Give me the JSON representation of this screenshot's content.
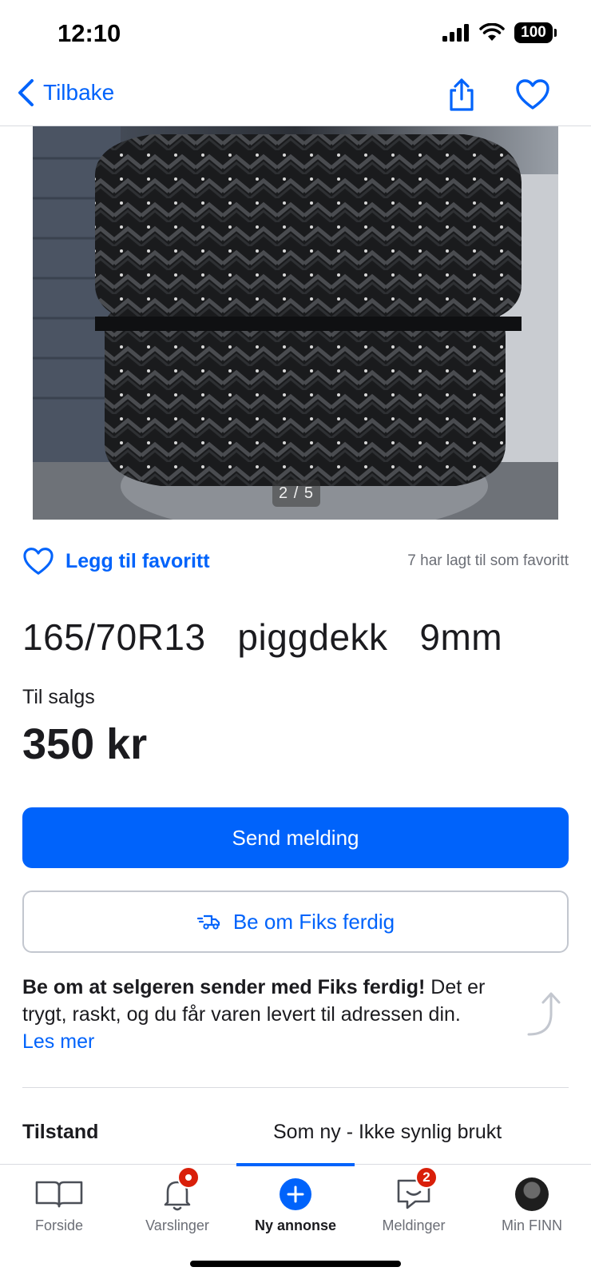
{
  "status_bar": {
    "time": "12:10",
    "battery": "100"
  },
  "nav": {
    "back_label": "Tilbake"
  },
  "gallery": {
    "counter": "2 / 5"
  },
  "favorite": {
    "action_label": "Legg til favoritt",
    "count_text": "7 har lagt til som favoritt"
  },
  "listing": {
    "title": "165/70R13   piggdekk   9mm",
    "sale_type": "Til salgs",
    "price": "350 kr"
  },
  "actions": {
    "send_message": "Send melding",
    "fiks_ferdig": "Be om Fiks ferdig"
  },
  "info": {
    "bold_text": "Be om at selgeren sender med Fiks ferdig!",
    "text": " Det er trygt, raskt, og du får varen levert til adressen din.",
    "read_more": "Les mer"
  },
  "specs": [
    {
      "label": "Tilstand",
      "value": "Som ny - Ikke synlig brukt"
    }
  ],
  "tab_bar": {
    "items": [
      {
        "label": "Forside",
        "icon": "book-icon"
      },
      {
        "label": "Varslinger",
        "icon": "bell-icon"
      },
      {
        "label": "Ny annonse",
        "icon": "plus-circle-icon"
      },
      {
        "label": "Meldinger",
        "icon": "chat-icon",
        "badge": "2"
      },
      {
        "label": "Min FINN",
        "icon": "avatar"
      }
    ]
  },
  "colors": {
    "accent": "#0063fb",
    "badge": "#d91f0a",
    "text": "#1b1b1f",
    "muted": "#6b6e76"
  }
}
